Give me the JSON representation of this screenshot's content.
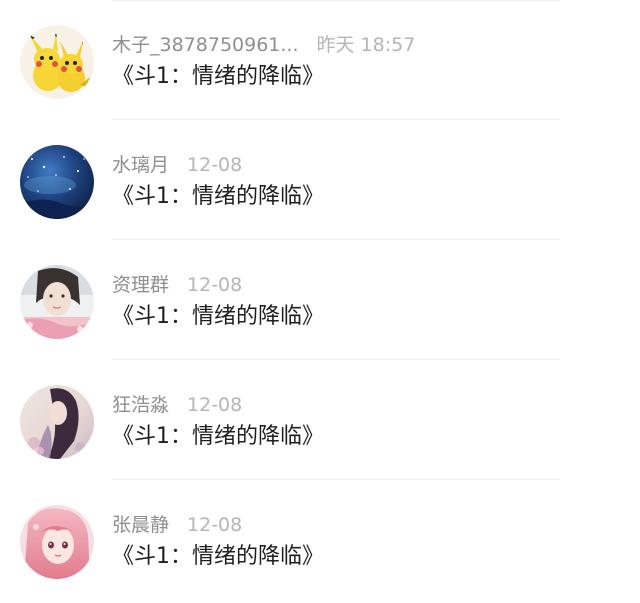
{
  "comments": [
    {
      "name": "木子_3878750961...",
      "time": "昨天 18:57",
      "content": "《斗1：情绪的降临》",
      "avatar_icon": "pikachu-avatar-icon"
    },
    {
      "name": "水璃月",
      "time": "12-08",
      "content": "《斗1：情绪的降临》",
      "avatar_icon": "starry-sky-avatar-icon"
    },
    {
      "name": "资理群",
      "time": "12-08",
      "content": "《斗1：情绪的降临》",
      "avatar_icon": "portrait-avatar-icon"
    },
    {
      "name": "狂浩淼",
      "time": "12-08",
      "content": "《斗1：情绪的降临》",
      "avatar_icon": "illustration-avatar-icon"
    },
    {
      "name": "张晨静",
      "time": "12-08",
      "content": "《斗1：情绪的降临》",
      "avatar_icon": "anime-girl-avatar-icon"
    }
  ],
  "colors": {
    "name": "#8f8f8f",
    "time": "#b5b5b5",
    "content": "#1f1f1f",
    "divider": "#eeeeee"
  }
}
